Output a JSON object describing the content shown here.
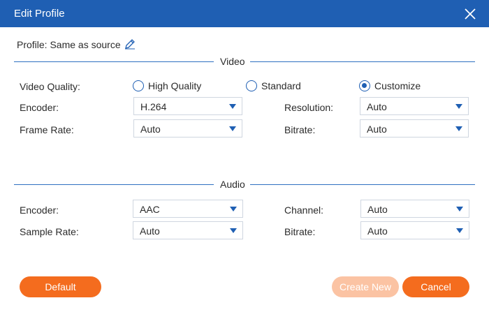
{
  "dialog": {
    "title": "Edit Profile"
  },
  "profile": {
    "label": "Profile:",
    "value": "Same as source"
  },
  "video": {
    "section_title": "Video",
    "quality_label": "Video Quality:",
    "quality_options": [
      "High Quality",
      "Standard",
      "Customize"
    ],
    "quality_selected": "Customize",
    "encoder_label": "Encoder:",
    "encoder_value": "H.264",
    "resolution_label": "Resolution:",
    "resolution_value": "Auto",
    "framerate_label": "Frame Rate:",
    "framerate_value": "Auto",
    "bitrate_label": "Bitrate:",
    "bitrate_value": "Auto"
  },
  "audio": {
    "section_title": "Audio",
    "encoder_label": "Encoder:",
    "encoder_value": "AAC",
    "channel_label": "Channel:",
    "channel_value": "Auto",
    "samplerate_label": "Sample Rate:",
    "samplerate_value": "Auto",
    "bitrate_label": "Bitrate:",
    "bitrate_value": "Auto"
  },
  "buttons": {
    "default_label": "Default",
    "create_new_label": "Create New",
    "cancel_label": "Cancel"
  },
  "colors": {
    "titlebar": "#1f5fb3",
    "accent": "#1f5fb3",
    "button_orange": "#f46c1e",
    "button_disabled": "#fbc3a3"
  },
  "icons": {
    "close": "close-icon",
    "edit": "pencil-icon",
    "dropdown": "chevron-down-icon"
  }
}
